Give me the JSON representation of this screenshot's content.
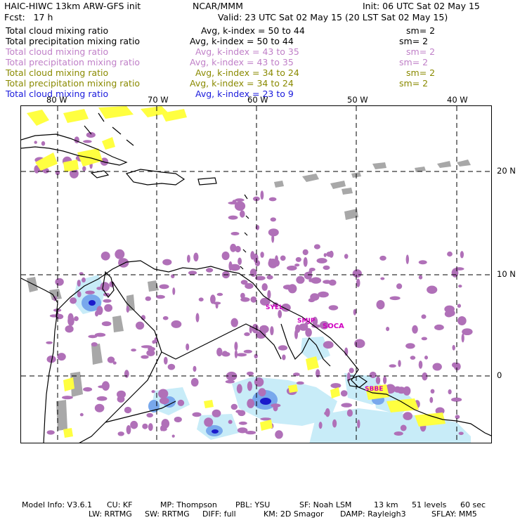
{
  "header": {
    "title": "HAIC-HIWC 13km ARW-GFS init",
    "org": "NCAR/MMM",
    "init": "Init: 06 UTC Sat 02 May 15",
    "fcst": "Fcst:   17 h",
    "valid": "Valid: 23 UTC Sat 02 May 15 (20 LST Sat 02 May 15)"
  },
  "fields": [
    {
      "name": "Total cloud mixing ratio",
      "range": "Avg, k-index =  50 to  44",
      "sm": "sm= 2",
      "color": "#000000"
    },
    {
      "name": "Total precipitation mixing ratio",
      "range": "Avg, k-index =  50 to  44",
      "sm": "sm= 2",
      "color": "#000000"
    },
    {
      "name": "Total cloud mixing ratio",
      "range": "Avg, k-index =  43 to  35",
      "sm": "sm= 2",
      "color": "#c080c8"
    },
    {
      "name": "Total precipitation mixing ratio",
      "range": "Avg, k-index =  43 to  35",
      "sm": "sm= 2",
      "color": "#c080c8"
    },
    {
      "name": "Total cloud mixing ratio",
      "range": "Avg, k-index =  34 to  24",
      "sm": "sm= 2",
      "color": "#8a8a00"
    },
    {
      "name": "Total precipitation mixing ratio",
      "range": "Avg, k-index =  34 to  24",
      "sm": "sm= 2",
      "color": "#8a8a00"
    },
    {
      "name": "Total cloud mixing ratio",
      "range": "Avg, k-index =  23 to   9",
      "sm": "",
      "color": "#1a1adc"
    }
  ],
  "map": {
    "lon_labels": [
      "80 W",
      "70 W",
      "60 W",
      "50 W",
      "40 W"
    ],
    "lat_labels": [
      "20 N",
      "10 N",
      "0"
    ],
    "stations": [
      "SYEL",
      "SMJP",
      "SOCA",
      "SBBE"
    ],
    "colors": {
      "purple": "#b070b8",
      "yellow": "#ffff40",
      "gray": "#a8a8a8",
      "lightblue": "#c8ecf8",
      "blue": "#5090e8",
      "darkblue": "#1a1acc",
      "coast": "#000000"
    }
  },
  "footer": {
    "line1": {
      "model": "Model Info: V3.6.1",
      "cu": "CU: KF",
      "mp": "MP: Thompson",
      "pbl": "PBL: YSU",
      "sf": "SF: Noah LSM",
      "res": "13 km",
      "levels": "51 levels",
      "dt": "60 sec"
    },
    "line2": {
      "lw": "LW: RRTMG",
      "sw": "SW: RRTMG",
      "diff": "DIFF: full",
      "km": "KM: 2D Smagor",
      "damp": "DAMP: Rayleigh3",
      "sflay": "SFLAY: MM5"
    }
  }
}
